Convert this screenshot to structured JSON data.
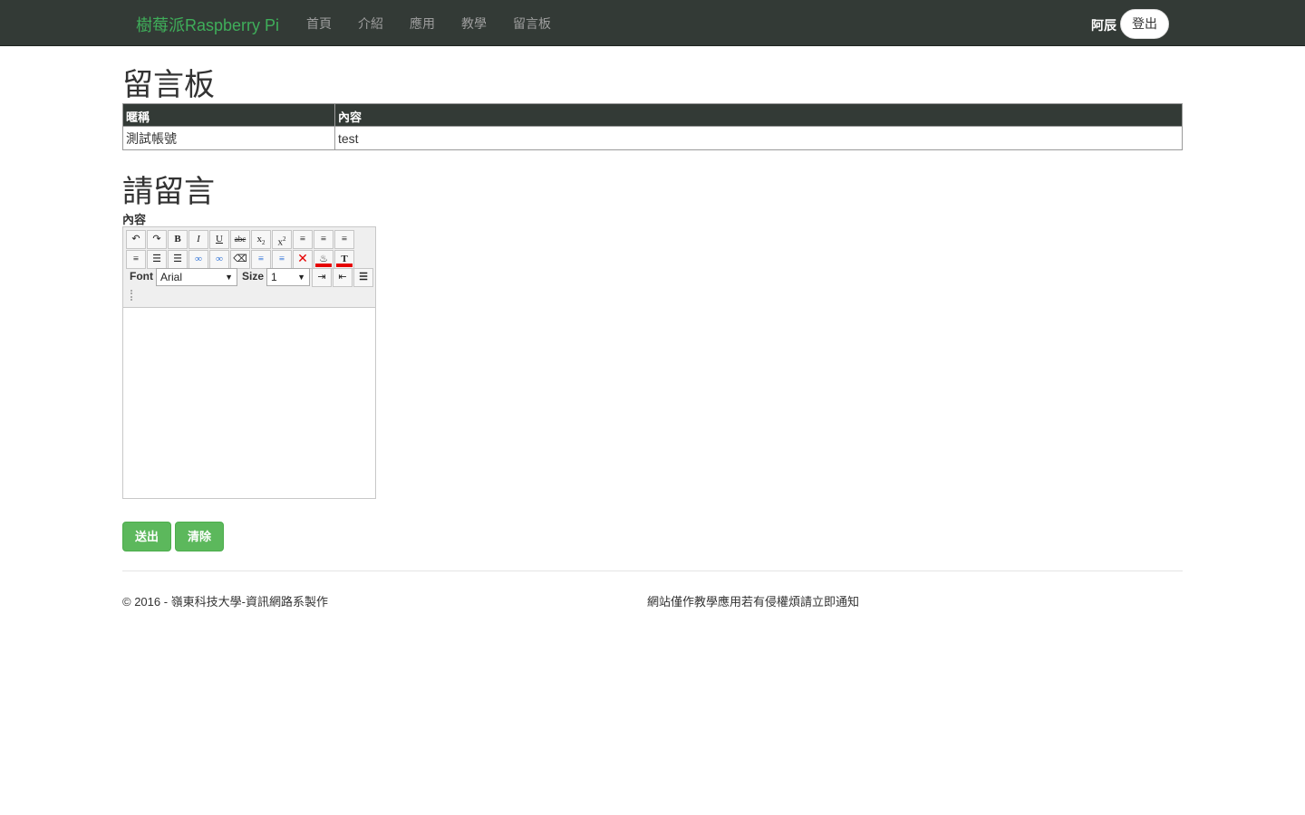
{
  "navbar": {
    "brand": "樹莓派Raspberry Pi",
    "items": [
      "首頁",
      "介紹",
      "應用",
      "教學",
      "留言板"
    ],
    "user": "阿辰",
    "logout": "登出"
  },
  "board": {
    "title": "留言板",
    "headers": [
      "暱稱",
      "內容"
    ],
    "rows": [
      [
        "測試帳號",
        "test"
      ]
    ]
  },
  "form": {
    "title": "請留言",
    "content_label": "內容",
    "editor": {
      "font_label": "Font",
      "font_value": "Arial",
      "size_label": "Size",
      "size_value": "1"
    },
    "send": "送出",
    "clear": "清除"
  },
  "footer": {
    "left": "© 2016 - 嶺東科技大學-資訊網路系製作",
    "right": "網站僅作教學應用若有侵權煩請立即通知"
  },
  "colors": {
    "navbar": "#333a36",
    "brand": "#3fae5a",
    "button": "#5cb85c"
  }
}
